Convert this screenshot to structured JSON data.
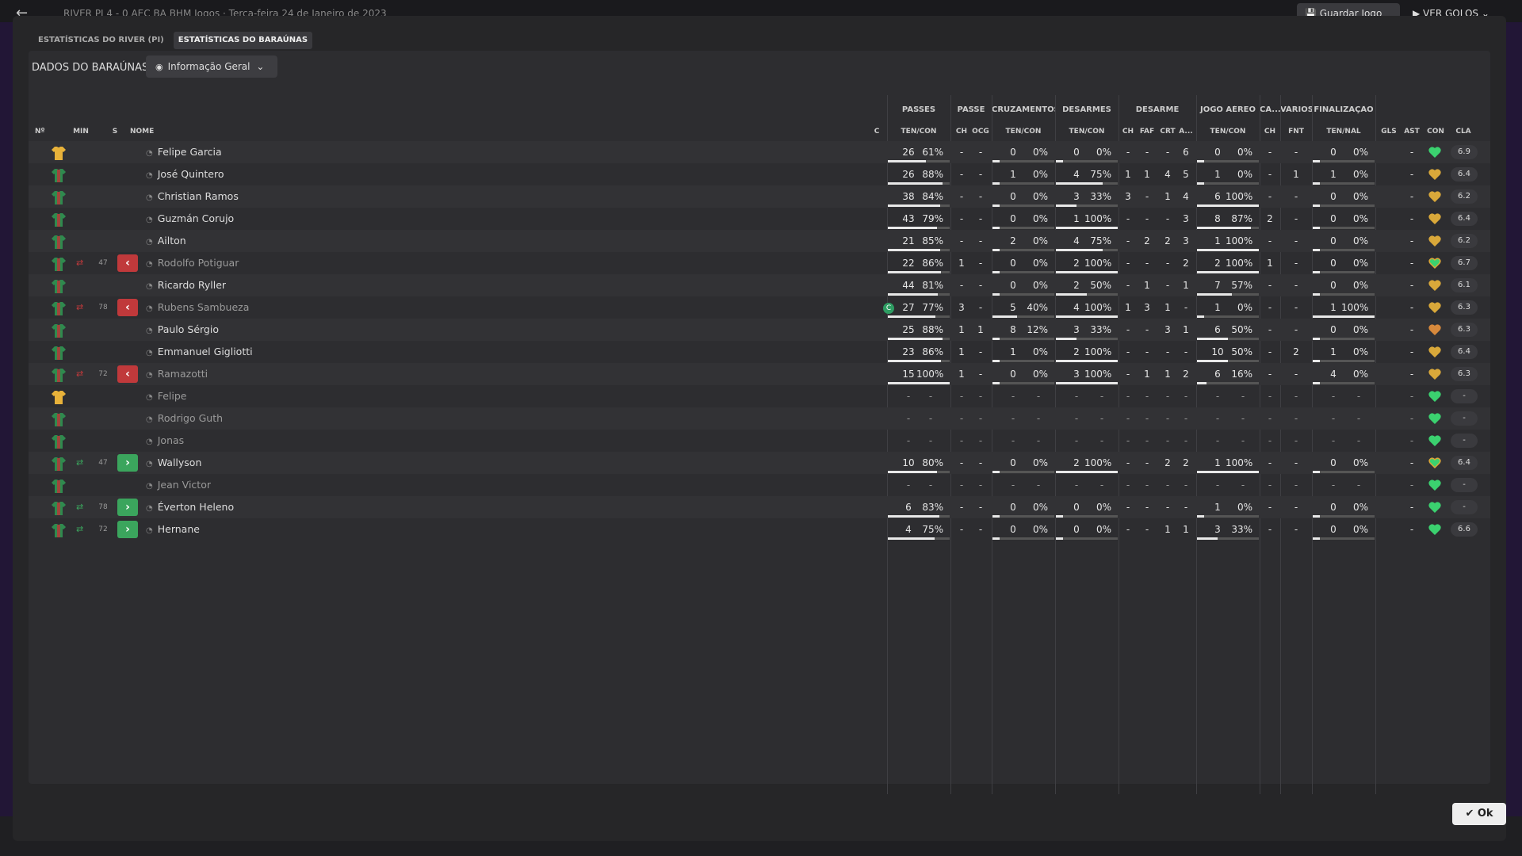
{
  "top": {
    "back": "←",
    "crumb": "RIVER PI   4 - 0   AEC BA   BHM Jogos  ·  Terça-feira 24 de Janeiro de 2023",
    "save": "💾 Guardar Jogo",
    "goals": "▶ VER GOLOS ⌄"
  },
  "tabs": [
    "ESTATÍSTICAS DO RIVER (PI)",
    "ESTATÍSTICAS DO BARAÚNAS"
  ],
  "panel": {
    "title": "DADOS DO BARAÚNAS",
    "dropdown": "Informação Geral"
  },
  "group_headers": [
    "PASSES",
    "PASSE",
    "CRUZAMENTOS",
    "DESARMES",
    "DESARME",
    "JOGO AÉREO",
    "CA...",
    "VÁRIOS",
    "FINALIZAÇÃO"
  ],
  "col_headers": [
    "Nº",
    "MIN",
    "S",
    "NOME",
    "C",
    "TEN/CON",
    "CH",
    "OCG",
    "TEN/CON",
    "TEN/CON",
    "CH",
    "FAF",
    "CRT",
    "A...",
    "TEN/CON",
    "CH",
    "FNT",
    "TEN/NAL",
    "GLS",
    "AST",
    "CON",
    "CLA"
  ],
  "colors": {
    "shirt_green": "#2f8a4e",
    "shirt_red": "#b33a3a",
    "gk_yellow": "#e8b23a",
    "heart_green": "#3bd16f",
    "heart_gold": "#d9a83a",
    "heart_orange": "#d7893c",
    "sub_off": "#c0393b",
    "sub_on": "#3ba55d"
  },
  "rows": [
    {
      "gk": true,
      "min": "",
      "sub": "",
      "name": "Felipe Garcia",
      "cap": false,
      "pass": [
        "26",
        "61%"
      ],
      "pass_pct": 61,
      "ch": "-",
      "ocg": "-",
      "cruz": [
        "0",
        "0%"
      ],
      "cruz_pct": 0,
      "des": [
        "0",
        "0%"
      ],
      "des_pct": 0,
      "d_ch": "-",
      "faf": "-",
      "crt": "-",
      "a": "6",
      "aer": [
        "0",
        "0%"
      ],
      "aer_pct": 0,
      "ca": "-",
      "fnt": "-",
      "fin": [
        "0",
        "0%"
      ],
      "fin_pct": 0,
      "gls": "",
      "ast": "-",
      "heart": "green",
      "cla": "6.9",
      "dim": false
    },
    {
      "gk": false,
      "min": "",
      "sub": "",
      "name": "José Quintero",
      "cap": false,
      "pass": [
        "26",
        "88%"
      ],
      "pass_pct": 88,
      "ch": "-",
      "ocg": "-",
      "cruz": [
        "1",
        "0%"
      ],
      "cruz_pct": 0,
      "des": [
        "4",
        "75%"
      ],
      "des_pct": 75,
      "d_ch": "1",
      "faf": "1",
      "crt": "4",
      "a": "5",
      "aer": [
        "1",
        "0%"
      ],
      "aer_pct": 0,
      "ca": "-",
      "fnt": "1",
      "fin": [
        "1",
        "0%"
      ],
      "fin_pct": 0,
      "gls": "",
      "ast": "-",
      "heart": "gold",
      "cla": "6.4",
      "dim": false
    },
    {
      "gk": false,
      "min": "",
      "sub": "",
      "name": "Christian Ramos",
      "cap": false,
      "pass": [
        "38",
        "84%"
      ],
      "pass_pct": 84,
      "ch": "-",
      "ocg": "-",
      "cruz": [
        "0",
        "0%"
      ],
      "cruz_pct": 0,
      "des": [
        "3",
        "33%"
      ],
      "des_pct": 33,
      "d_ch": "3",
      "faf": "-",
      "crt": "1",
      "a": "4",
      "aer": [
        "6",
        "100%"
      ],
      "aer_pct": 100,
      "ca": "-",
      "fnt": "-",
      "fin": [
        "0",
        "0%"
      ],
      "fin_pct": 0,
      "gls": "",
      "ast": "-",
      "heart": "gold",
      "cla": "6.2",
      "dim": false
    },
    {
      "gk": false,
      "min": "",
      "sub": "",
      "name": "Guzmán Corujo",
      "cap": false,
      "pass": [
        "43",
        "79%"
      ],
      "pass_pct": 79,
      "ch": "-",
      "ocg": "-",
      "cruz": [
        "0",
        "0%"
      ],
      "cruz_pct": 0,
      "des": [
        "1",
        "100%"
      ],
      "des_pct": 100,
      "d_ch": "-",
      "faf": "-",
      "crt": "-",
      "a": "3",
      "aer": [
        "8",
        "87%"
      ],
      "aer_pct": 87,
      "ca": "2",
      "fnt": "-",
      "fin": [
        "0",
        "0%"
      ],
      "fin_pct": 0,
      "gls": "",
      "ast": "-",
      "heart": "gold",
      "cla": "6.4",
      "dim": false
    },
    {
      "gk": false,
      "min": "",
      "sub": "",
      "name": "Ailton",
      "cap": false,
      "pass": [
        "21",
        "85%"
      ],
      "pass_pct": 85,
      "ch": "-",
      "ocg": "-",
      "cruz": [
        "2",
        "0%"
      ],
      "cruz_pct": 0,
      "des": [
        "4",
        "75%"
      ],
      "des_pct": 75,
      "d_ch": "-",
      "faf": "2",
      "crt": "2",
      "a": "3",
      "aer": [
        "1",
        "100%"
      ],
      "aer_pct": 100,
      "ca": "-",
      "fnt": "-",
      "fin": [
        "0",
        "0%"
      ],
      "fin_pct": 0,
      "gls": "",
      "ast": "-",
      "heart": "gold",
      "cla": "6.2",
      "dim": false
    },
    {
      "gk": false,
      "min": "47",
      "sub": "off",
      "name": "Rodolfo Potiguar",
      "cap": false,
      "pass": [
        "22",
        "86%"
      ],
      "pass_pct": 86,
      "ch": "1",
      "ocg": "-",
      "cruz": [
        "0",
        "0%"
      ],
      "cruz_pct": 0,
      "des": [
        "2",
        "100%"
      ],
      "des_pct": 100,
      "d_ch": "-",
      "faf": "-",
      "crt": "-",
      "a": "2",
      "aer": [
        "2",
        "100%"
      ],
      "aer_pct": 100,
      "ca": "1",
      "fnt": "-",
      "fin": [
        "0",
        "0%"
      ],
      "fin_pct": 0,
      "gls": "",
      "ast": "-",
      "heart": "green-gold",
      "cla": "6.7",
      "dim": true
    },
    {
      "gk": false,
      "min": "",
      "sub": "",
      "name": "Ricardo Ryller",
      "cap": false,
      "pass": [
        "44",
        "81%"
      ],
      "pass_pct": 81,
      "ch": "-",
      "ocg": "-",
      "cruz": [
        "0",
        "0%"
      ],
      "cruz_pct": 0,
      "des": [
        "2",
        "50%"
      ],
      "des_pct": 50,
      "d_ch": "-",
      "faf": "1",
      "crt": "-",
      "a": "1",
      "aer": [
        "7",
        "57%"
      ],
      "aer_pct": 57,
      "ca": "-",
      "fnt": "-",
      "fin": [
        "0",
        "0%"
      ],
      "fin_pct": 0,
      "gls": "",
      "ast": "-",
      "heart": "gold",
      "cla": "6.1",
      "dim": false
    },
    {
      "gk": false,
      "min": "78",
      "sub": "off",
      "name": "Rubens Sambueza",
      "cap": true,
      "pass": [
        "27",
        "77%"
      ],
      "pass_pct": 77,
      "ch": "3",
      "ocg": "-",
      "cruz": [
        "5",
        "40%"
      ],
      "cruz_pct": 40,
      "des": [
        "4",
        "100%"
      ],
      "des_pct": 100,
      "d_ch": "1",
      "faf": "3",
      "crt": "1",
      "a": "-",
      "aer": [
        "1",
        "0%"
      ],
      "aer_pct": 0,
      "ca": "-",
      "fnt": "-",
      "fin": [
        "1",
        "100%"
      ],
      "fin_pct": 100,
      "gls": "",
      "ast": "-",
      "heart": "gold",
      "cla": "6.3",
      "dim": true
    },
    {
      "gk": false,
      "min": "",
      "sub": "",
      "name": "Paulo Sérgio",
      "cap": false,
      "pass": [
        "25",
        "88%"
      ],
      "pass_pct": 88,
      "ch": "1",
      "ocg": "1",
      "cruz": [
        "8",
        "12%"
      ],
      "cruz_pct": 12,
      "des": [
        "3",
        "33%"
      ],
      "des_pct": 33,
      "d_ch": "-",
      "faf": "-",
      "crt": "3",
      "a": "1",
      "aer": [
        "6",
        "50%"
      ],
      "aer_pct": 50,
      "ca": "-",
      "fnt": "-",
      "fin": [
        "0",
        "0%"
      ],
      "fin_pct": 0,
      "gls": "",
      "ast": "-",
      "heart": "orange",
      "cla": "6.3",
      "dim": false
    },
    {
      "gk": false,
      "min": "",
      "sub": "",
      "name": "Emmanuel Gigliotti",
      "cap": false,
      "pass": [
        "23",
        "86%"
      ],
      "pass_pct": 86,
      "ch": "1",
      "ocg": "-",
      "cruz": [
        "1",
        "0%"
      ],
      "cruz_pct": 0,
      "des": [
        "2",
        "100%"
      ],
      "des_pct": 100,
      "d_ch": "-",
      "faf": "-",
      "crt": "-",
      "a": "-",
      "aer": [
        "10",
        "50%"
      ],
      "aer_pct": 50,
      "ca": "-",
      "fnt": "2",
      "fin": [
        "1",
        "0%"
      ],
      "fin_pct": 0,
      "gls": "",
      "ast": "-",
      "heart": "gold",
      "cla": "6.4",
      "dim": false
    },
    {
      "gk": false,
      "min": "72",
      "sub": "off",
      "name": "Ramazotti",
      "cap": false,
      "pass": [
        "15",
        "100%"
      ],
      "pass_pct": 100,
      "ch": "1",
      "ocg": "-",
      "cruz": [
        "0",
        "0%"
      ],
      "cruz_pct": 0,
      "des": [
        "3",
        "100%"
      ],
      "des_pct": 100,
      "d_ch": "-",
      "faf": "1",
      "crt": "1",
      "a": "2",
      "aer": [
        "6",
        "16%"
      ],
      "aer_pct": 16,
      "ca": "-",
      "fnt": "-",
      "fin": [
        "4",
        "0%"
      ],
      "fin_pct": 0,
      "gls": "",
      "ast": "-",
      "heart": "gold",
      "cla": "6.3",
      "dim": true
    },
    {
      "gk": true,
      "min": "",
      "sub": "",
      "name": "Felipe",
      "cap": false,
      "empty": true,
      "heart": "green",
      "cla": "-",
      "dim": true
    },
    {
      "gk": false,
      "min": "",
      "sub": "",
      "name": "Rodrigo Guth",
      "cap": false,
      "empty": true,
      "heart": "green",
      "cla": "-",
      "dim": true
    },
    {
      "gk": false,
      "min": "",
      "sub": "",
      "name": "Jonas",
      "cap": false,
      "empty": true,
      "heart": "green",
      "cla": "-",
      "dim": true
    },
    {
      "gk": false,
      "min": "47",
      "sub": "on",
      "name": "Wallyson",
      "cap": false,
      "pass": [
        "10",
        "80%"
      ],
      "pass_pct": 80,
      "ch": "-",
      "ocg": "-",
      "cruz": [
        "0",
        "0%"
      ],
      "cruz_pct": 0,
      "des": [
        "2",
        "100%"
      ],
      "des_pct": 100,
      "d_ch": "-",
      "faf": "-",
      "crt": "2",
      "a": "2",
      "aer": [
        "1",
        "100%"
      ],
      "aer_pct": 100,
      "ca": "-",
      "fnt": "-",
      "fin": [
        "0",
        "0%"
      ],
      "fin_pct": 0,
      "gls": "",
      "ast": "-",
      "heart": "green-gold",
      "cla": "6.4",
      "dim": false
    },
    {
      "gk": false,
      "min": "",
      "sub": "",
      "name": "Jean Victor",
      "cap": false,
      "empty": true,
      "heart": "green",
      "cla": "-",
      "dim": true
    },
    {
      "gk": false,
      "min": "78",
      "sub": "on",
      "name": "Éverton Heleno",
      "cap": false,
      "pass": [
        "6",
        "83%"
      ],
      "pass_pct": 83,
      "ch": "-",
      "ocg": "-",
      "cruz": [
        "0",
        "0%"
      ],
      "cruz_pct": 0,
      "des": [
        "0",
        "0%"
      ],
      "des_pct": 0,
      "d_ch": "-",
      "faf": "-",
      "crt": "-",
      "a": "-",
      "aer": [
        "1",
        "0%"
      ],
      "aer_pct": 0,
      "ca": "-",
      "fnt": "-",
      "fin": [
        "0",
        "0%"
      ],
      "fin_pct": 0,
      "gls": "",
      "ast": "-",
      "heart": "green",
      "cla": "-",
      "dim": false
    },
    {
      "gk": false,
      "min": "72",
      "sub": "on",
      "name": "Hernane",
      "cap": false,
      "pass": [
        "4",
        "75%"
      ],
      "pass_pct": 75,
      "ch": "-",
      "ocg": "-",
      "cruz": [
        "0",
        "0%"
      ],
      "cruz_pct": 0,
      "des": [
        "0",
        "0%"
      ],
      "des_pct": 0,
      "d_ch": "-",
      "faf": "-",
      "crt": "1",
      "a": "1",
      "aer": [
        "3",
        "33%"
      ],
      "aer_pct": 33,
      "ca": "-",
      "fnt": "-",
      "fin": [
        "0",
        "0%"
      ],
      "fin_pct": 0,
      "gls": "",
      "ast": "-",
      "heart": "green",
      "cla": "6.6",
      "dim": false
    }
  ],
  "ok": "Ok"
}
